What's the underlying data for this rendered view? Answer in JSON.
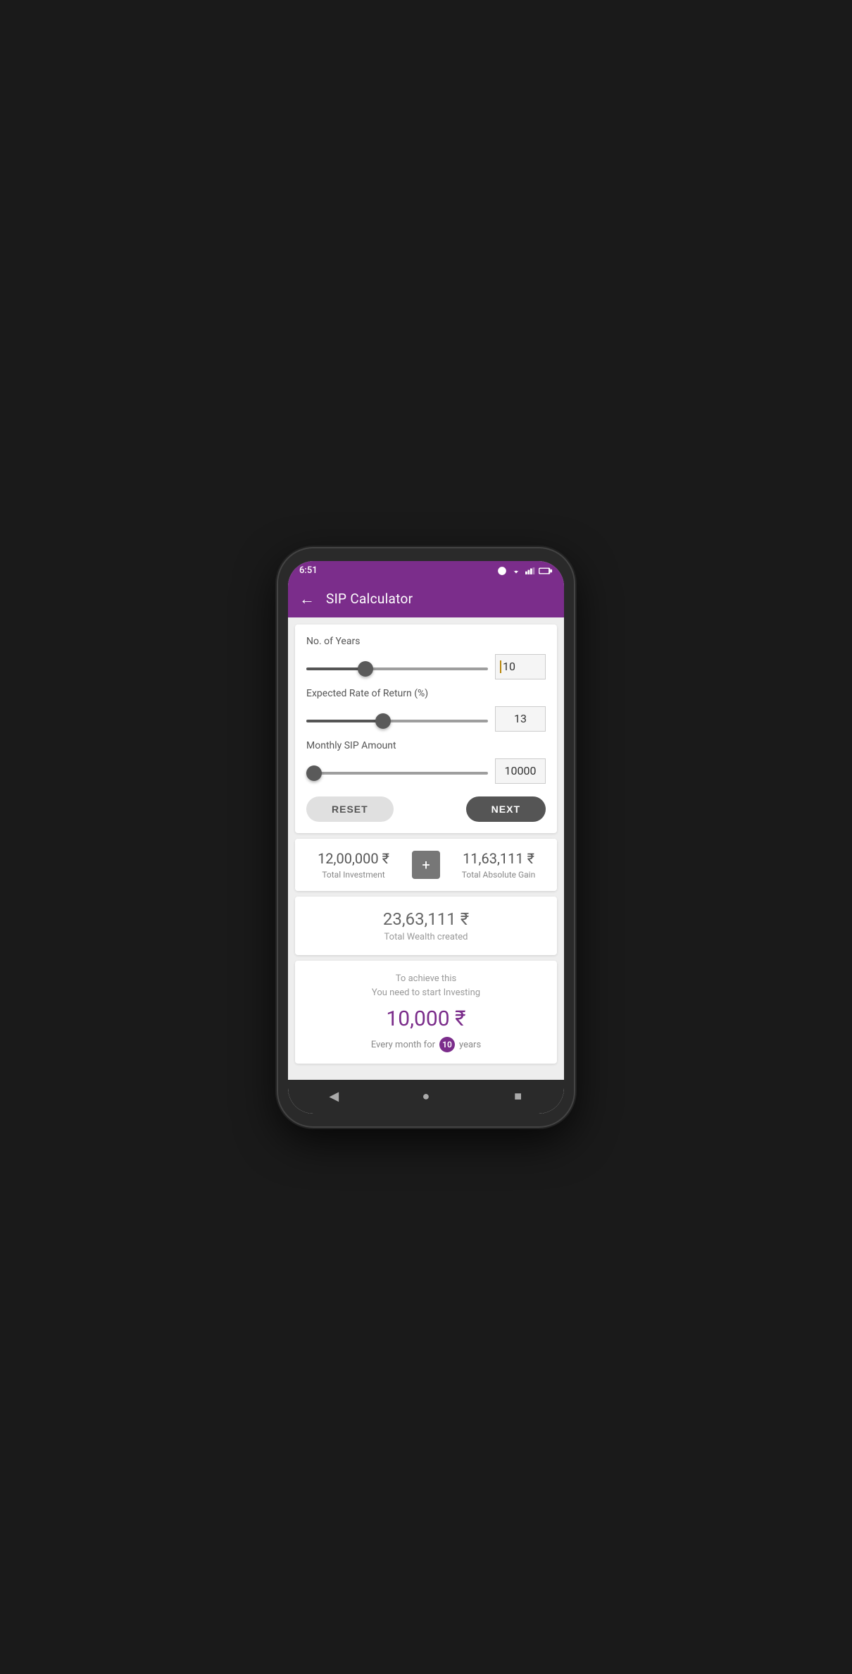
{
  "statusBar": {
    "time": "6:51",
    "icons": [
      "notification",
      "wifi",
      "signal",
      "battery"
    ]
  },
  "appBar": {
    "title": "SIP Calculator",
    "backLabel": "←"
  },
  "calculator": {
    "fields": [
      {
        "label": "No. of Years",
        "value": "10",
        "sliderMin": 1,
        "sliderMax": 30,
        "sliderValue": 10,
        "hasCursor": true
      },
      {
        "label": "Expected Rate of Return (%)",
        "value": "13",
        "sliderMin": 1,
        "sliderMax": 30,
        "sliderValue": 13,
        "hasCursor": false
      },
      {
        "label": "Monthly SIP Amount",
        "value": "10000",
        "sliderMin": 500,
        "sliderMax": 100000,
        "sliderValue": 500,
        "hasCursor": false
      }
    ],
    "resetButton": "RESET",
    "nextButton": "NEXT"
  },
  "results": {
    "totalInvestment": {
      "amount": "12,00,000 ₹",
      "label": "Total Investment"
    },
    "plusIcon": "+",
    "totalGain": {
      "amount": "11,63,111 ₹",
      "label": "Total Absolute Gain"
    },
    "totalWealth": {
      "amount": "23,63,111 ₹",
      "label": "Total Wealth created"
    }
  },
  "investSummary": {
    "intro1": "To achieve this",
    "intro2": "You need to start Investing",
    "amount": "10,000 ₹",
    "durationText1": "Every month for",
    "years": "10",
    "durationText2": "years"
  },
  "navBar": {
    "back": "◀",
    "home": "●",
    "recent": "■"
  }
}
